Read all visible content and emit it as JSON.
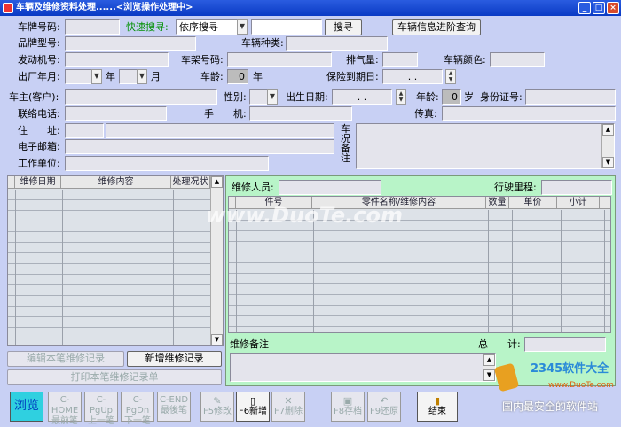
{
  "window": {
    "title": "车辆及维修资料处理......<浏览操作处理中>",
    "min": "_",
    "max": "□",
    "close": "×"
  },
  "top": {
    "plate_label": "车牌号码:",
    "quick_label": "快速搜寻:",
    "search_mode": "依序搜寻",
    "search_btn": "搜寻",
    "adv_btn": "车辆信息进阶查询",
    "model_label": "品牌型号:",
    "type_label": "车辆种类:",
    "engine_label": "发动机号:",
    "frame_label": "车架号码:",
    "disp_label": "排气量:",
    "color_label": "车辆颜色:",
    "prod_label": "出厂年月:",
    "year_unit": "年",
    "month_unit": "月",
    "age_label": "车龄:",
    "age_val": "0",
    "age_unit": "年",
    "ins_label": "保险到期日:",
    "ins_val": ". ."
  },
  "owner": {
    "owner_label": "车主(客户):",
    "sex_label": "性别:",
    "birth_label": "出生日期:",
    "birth_val": ". .",
    "oage_label": "年龄:",
    "oage_val": "0",
    "oage_unit": "岁",
    "id_label": "身份证号:",
    "phone_label": "联络电话:",
    "mobile_label": "手　　机:",
    "fax_label": "传真:",
    "addr_label": "住　　址:",
    "email_label": "电子邮箱:",
    "work_label": "工作单位:",
    "note_label": "车况备注"
  },
  "history": {
    "columns": [
      "维修日期",
      "维修内容",
      "处理况状"
    ]
  },
  "buttons": {
    "edit": "编辑本笔维修记录",
    "add": "新增维修记录",
    "print": "打印本笔维修记录单"
  },
  "repair": {
    "staff_label": "维修人员:",
    "mileage_label": "行驶里程:",
    "columns": [
      "件号",
      "零件名称/维修内容",
      "数量",
      "单价",
      "小计"
    ],
    "note_label": "维修备注",
    "total_label": "总　　计:"
  },
  "toolbar": [
    {
      "label": "浏览",
      "sub": ""
    },
    {
      "label": "C-HOME",
      "sub": "最前笔"
    },
    {
      "label": "C-PgUp",
      "sub": "上一笔"
    },
    {
      "label": "C-PgDn",
      "sub": "下一笔"
    },
    {
      "label": "C-END",
      "sub": "最後笔"
    },
    {
      "label": "F5修改",
      "sub": ""
    },
    {
      "label": "F6新增",
      "sub": ""
    },
    {
      "label": "F7删除",
      "sub": ""
    },
    {
      "label": "F8存档",
      "sub": ""
    },
    {
      "label": "F9还原",
      "sub": ""
    },
    {
      "label": "结束",
      "sub": ""
    }
  ],
  "watermark": {
    "text": "www.DuoTe.com",
    "logo": "2345软件大全",
    "logo_url": "www.DuoTe.com",
    "slogan": "国内最安全的软件站"
  }
}
